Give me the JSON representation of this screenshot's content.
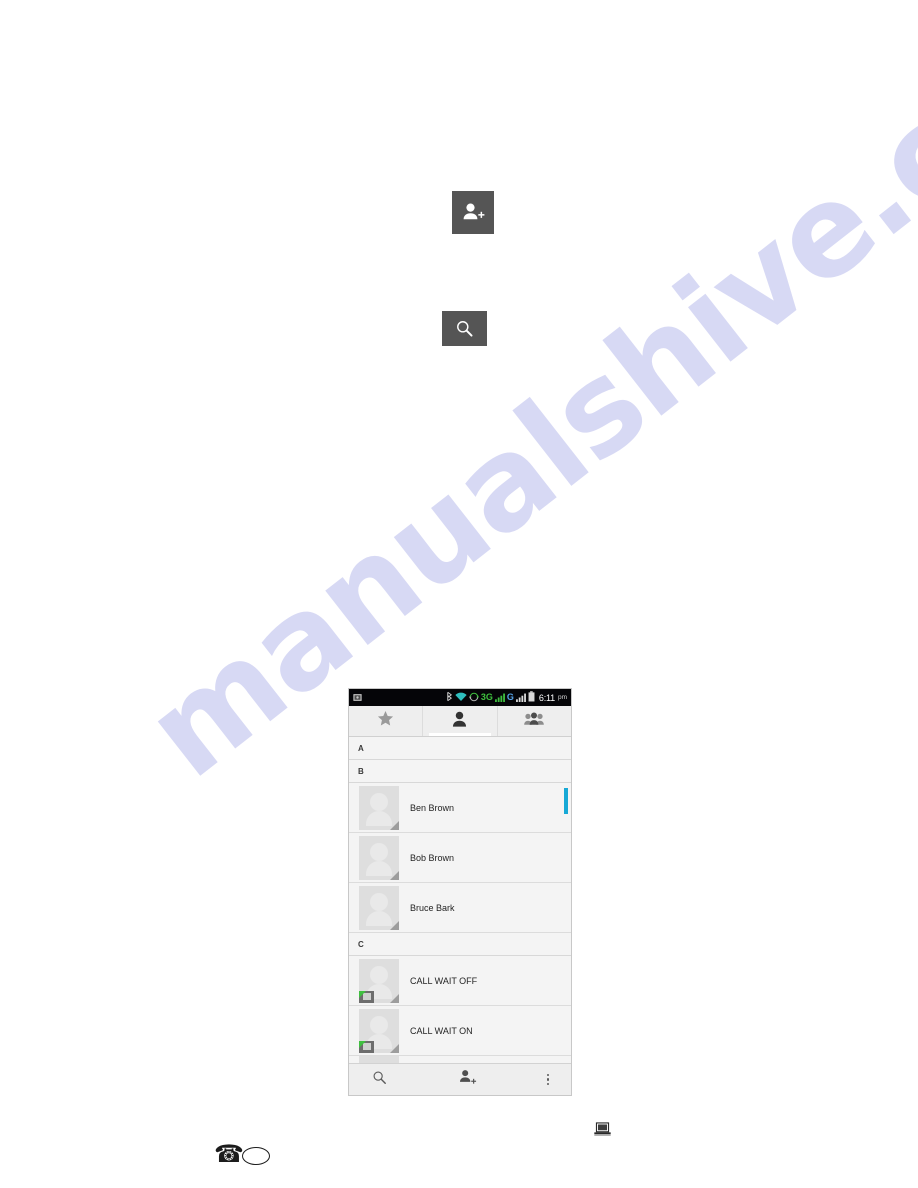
{
  "page": {
    "background_color": "#ffffff",
    "watermark_text": "manualshive.com",
    "watermark_color": "#c9cbf0"
  },
  "instruction_buttons": [
    {
      "name": "add-contact",
      "icon": "person-add-icon",
      "background_color": "#555555",
      "icon_color": "#ffffff"
    },
    {
      "name": "search",
      "icon": "search-icon",
      "background_color": "#555555",
      "icon_color": "#ffffff"
    }
  ],
  "phone": {
    "status_bar": {
      "background_color": "#050508",
      "left_icons": [
        "screenshot-icon"
      ],
      "right_icons": [
        "bluetooth-icon",
        "wifi-icon",
        "sync-icon",
        "signal-3g-icon",
        "signal-g-icon",
        "battery-icon"
      ],
      "network_primary": "3G",
      "network_secondary": "G",
      "network_primary_color": "#3ec13e",
      "network_secondary_color": "#56a4ea",
      "time": "6:11",
      "time_suffix": "pm"
    },
    "tabs": [
      {
        "name": "favorites",
        "icon": "star-icon",
        "active": false
      },
      {
        "name": "contacts",
        "icon": "person-icon",
        "active": true
      },
      {
        "name": "groups",
        "icon": "group-icon",
        "active": false
      }
    ],
    "list": [
      {
        "type": "section",
        "label": "A"
      },
      {
        "type": "section",
        "label": "B"
      },
      {
        "type": "contact",
        "label": "Ben Brown",
        "sim_badge": false
      },
      {
        "type": "contact",
        "label": "Bob Brown",
        "sim_badge": false
      },
      {
        "type": "contact",
        "label": "Bruce Bark",
        "sim_badge": false
      },
      {
        "type": "section",
        "label": "C"
      },
      {
        "type": "contact",
        "label": "CALL WAIT OFF",
        "sim_badge": true
      },
      {
        "type": "contact",
        "label": "CALL WAIT ON",
        "sim_badge": true
      },
      {
        "type": "contact-partial",
        "label": "",
        "sim_badge": false
      }
    ],
    "scrollbar": {
      "color": "#17a9d6"
    },
    "action_bar": {
      "background_color": "#eeeeee",
      "actions": [
        {
          "name": "search",
          "icon": "search-icon"
        },
        {
          "name": "add-contact",
          "icon": "person-add-icon"
        },
        {
          "name": "more-options",
          "icon": "overflow-menu-icon"
        }
      ]
    }
  },
  "footer": {
    "phone_glyph": "☎",
    "oval_shape": "oval",
    "laptop_icon": "laptop-icon"
  }
}
